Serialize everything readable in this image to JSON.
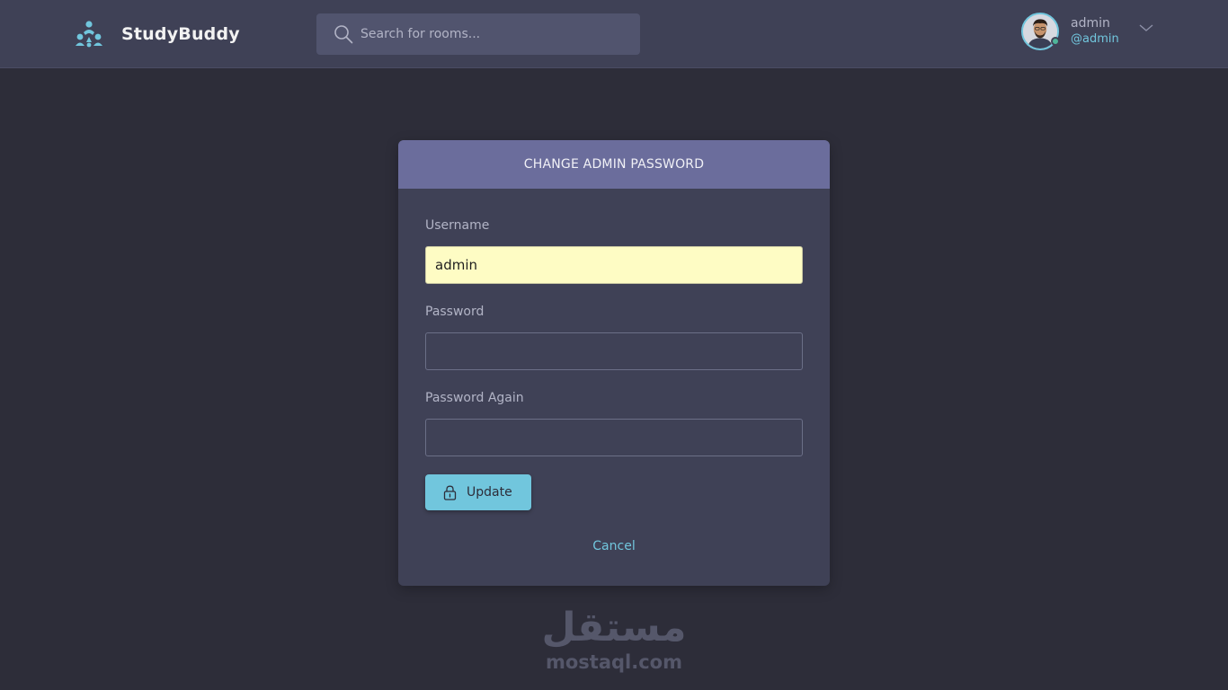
{
  "header": {
    "brand": "StudyBuddy",
    "logo_icon": "studybuddy-logo-icon",
    "search": {
      "placeholder": "Search for rooms...",
      "value": "",
      "icon": "search-icon"
    },
    "user": {
      "name": "admin",
      "handle": "@admin",
      "avatar_icon": "avatar",
      "status": "online",
      "menu_icon": "chevron-down-icon"
    }
  },
  "form": {
    "title": "CHANGE ADMIN PASSWORD",
    "username_label": "Username",
    "username_value": "admin",
    "password_label": "Password",
    "password_value": "",
    "password_again_label": "Password Again",
    "password_again_value": "",
    "submit_label": "Update",
    "submit_icon": "lock-icon",
    "cancel_label": "Cancel"
  },
  "watermark": {
    "arabic": "مستقل",
    "latin": "mostaql.com"
  },
  "colors": {
    "background": "#2d2d39",
    "header": "#3f4156",
    "card": "#3f4156",
    "card_header": "#6b6d9c",
    "accent": "#71c6dd",
    "autofill": "#fefcc4",
    "status_online": "#4fb59a"
  }
}
